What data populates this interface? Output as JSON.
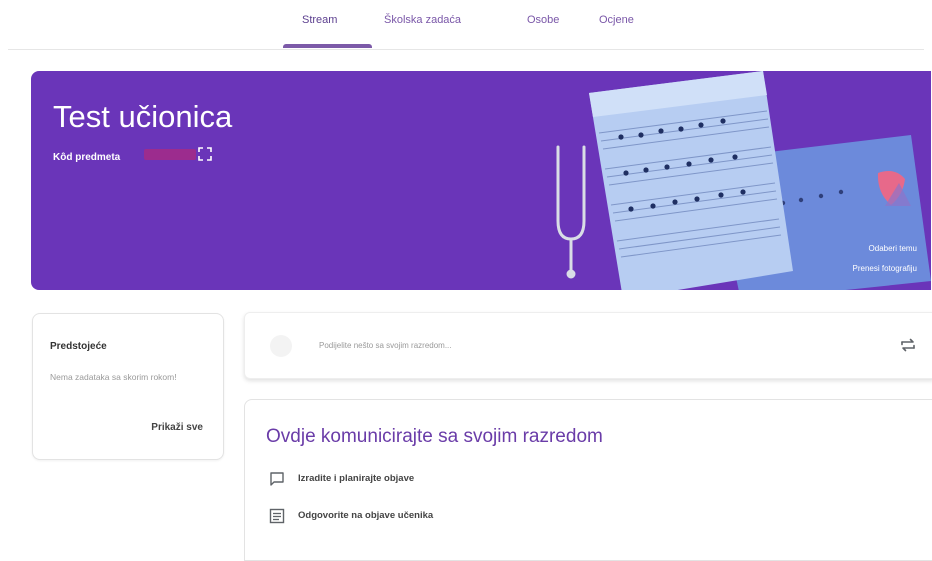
{
  "tabs": [
    {
      "label": "Stream",
      "active": true
    },
    {
      "label": "Školska zadaća",
      "active": false
    },
    {
      "label": "Osobe",
      "active": false
    },
    {
      "label": "Ocjene",
      "active": false
    }
  ],
  "banner": {
    "title": "Test učionica",
    "code_label": "Kôd predmeta",
    "select_theme": "Odaberi temu",
    "upload_photo": "Prenesi fotografiju",
    "background_color": "#6a35b9"
  },
  "upcoming": {
    "title": "Predstojeće",
    "empty_text": "Nema zadataka sa skorim rokom!",
    "view_all": "Prikaži sve"
  },
  "share": {
    "placeholder": "Podijelite nešto sa svojim razredom..."
  },
  "info": {
    "title": "Ovdje komunicirajte sa svojim razredom",
    "items": [
      {
        "icon": "comment-icon",
        "label": "Izradite i planirajte objave"
      },
      {
        "icon": "reply-list-icon",
        "label": "Odgovorite na objave učenika"
      }
    ]
  },
  "colors": {
    "accent": "#7c5aa8",
    "banner": "#6a35b9",
    "title": "#6a3ca8"
  }
}
